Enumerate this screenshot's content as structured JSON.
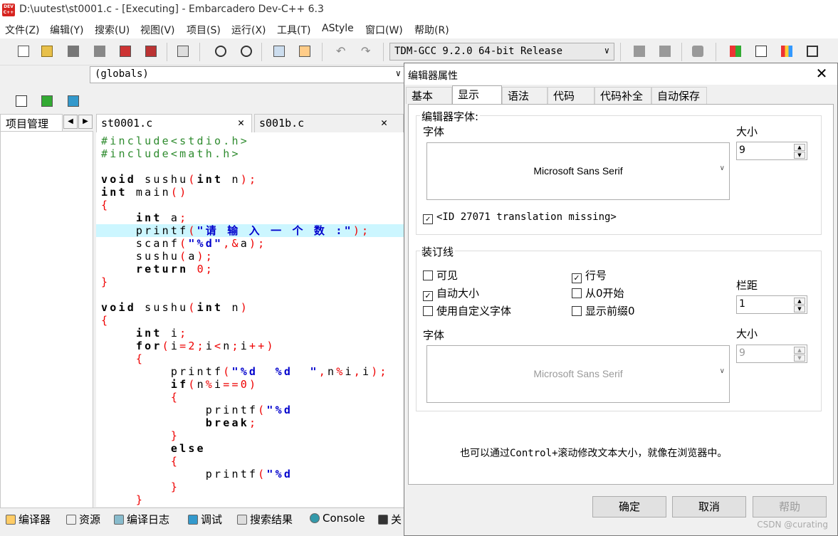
{
  "window": {
    "title": "D:\\uutest\\st0001.c - [Executing] - Embarcadero Dev-C++ 6.3",
    "logo": "DEV C++"
  },
  "menu": [
    "文件(Z)",
    "编辑(Y)",
    "搜索(U)",
    "视图(V)",
    "项目(S)",
    "运行(X)",
    "工具(T)",
    "AStyle",
    "窗口(W)",
    "帮助(R)"
  ],
  "toolbar": {
    "compiler": "TDM-GCC 9.2.0 64-bit Release"
  },
  "scope": {
    "value": "(globals)"
  },
  "project": {
    "tab": "项目管理"
  },
  "editor": {
    "tabs": [
      "st0001.c",
      "s001b.c"
    ]
  },
  "code": [
    "#include<stdio.h>",
    "#include<math.h>",
    "",
    "void sushu(int n);",
    "int main()",
    "{",
    "    int a;",
    "    printf(\"请 输 入 一 个 数 :\");",
    "    scanf(\"%d\",&a);",
    "    sushu(a);",
    "    return 0;",
    "}",
    "",
    "void sushu(int n)",
    "{",
    "    int i;",
    "    for(i=2;i<n;i++)",
    "    {",
    "        printf(\"%d  %d  \",n%i,i);",
    "        if(n%i==0)",
    "        {",
    "            printf(\"%d",
    "            break;",
    "        }",
    "        else",
    "        {",
    "            printf(\"%d",
    "        }",
    "    }"
  ],
  "bottom_tabs": [
    "编译器",
    "资源",
    "编译日志",
    "调试",
    "搜索结果",
    "Console",
    "关"
  ],
  "dialog": {
    "title": "编辑器属性",
    "tabs": [
      "基本",
      "显示",
      "语法",
      "代码",
      "代码补全",
      "自动保存"
    ],
    "active_tab": "显示",
    "editor_font": {
      "group": "编辑器字体:",
      "font_label": "字体",
      "font": "Microsoft Sans Serif",
      "size_label": "大小",
      "size": "9",
      "checkbox": "<ID 27071 translation missing>",
      "checked": true
    },
    "gutter": {
      "group": "装订线",
      "visible": "可见",
      "auto_size": "自动大小",
      "custom_font": "使用自定义字体",
      "line_numbers": "行号",
      "start_zero": "从0开始",
      "leading_zero": "显示前缀0",
      "margin_label": "栏距",
      "margin": "1",
      "font_label": "字体",
      "font": "Microsoft Sans Serif",
      "size_label": "大小",
      "size": "9"
    },
    "hint": "也可以通过Control+滚动修改文本大小，就像在浏览器中。",
    "buttons": {
      "ok": "确定",
      "cancel": "取消",
      "help": "帮助"
    }
  },
  "watermark": "CSDN @curating"
}
